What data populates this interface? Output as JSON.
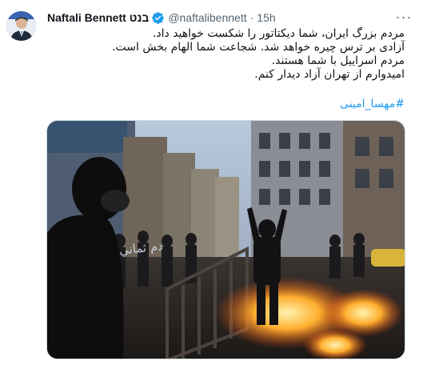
{
  "author": {
    "display_name": "Naftali Bennett בנט",
    "handle": "@naftalibennett",
    "separator": "·",
    "time": "15h",
    "verified_icon": "verified-badge-icon",
    "more_icon": "more-options-icon"
  },
  "tweet": {
    "lines": [
      "مردم بزرگ ایران، شما دیکتاتور را شکست خواهید داد.",
      "آزادی بر ترس چیره خواهد شد. شجاعت شما الهام بخش است.",
      "مردم اسراییل با شما هستند.",
      "امیدوارم از تهران آزاد دیدار کنم."
    ],
    "hashtag": "#مهسا_امینی"
  },
  "media": {
    "sign_text": "دم ثماني"
  },
  "colors": {
    "link": "#1d9bf0",
    "secondary_text": "#536471",
    "primary_text": "#0f1419",
    "verified": "#1d9bf0"
  }
}
